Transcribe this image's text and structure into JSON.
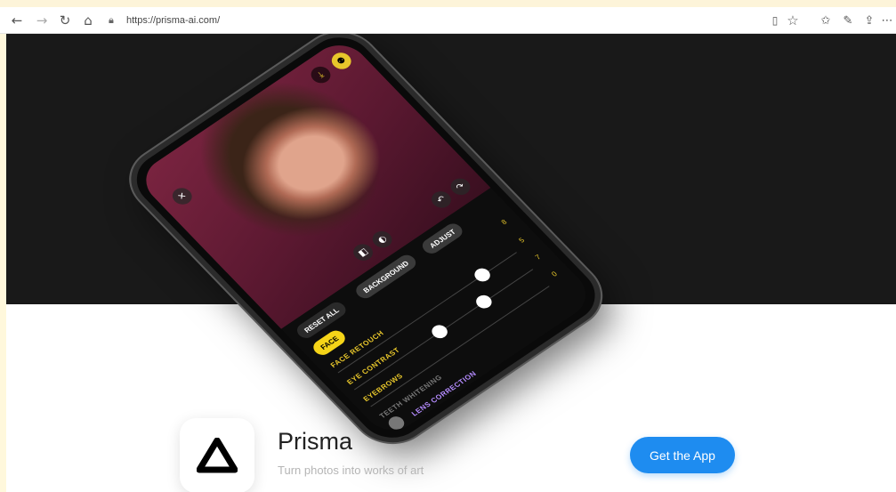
{
  "browser": {
    "url": "https://prisma-ai.com/",
    "icons": {
      "back": "back-arrow-icon",
      "forward": "forward-arrow-icon",
      "refresh": "refresh-icon",
      "home": "home-icon",
      "lock": "lock-icon",
      "reading_view": "reading-view-icon",
      "favorite": "star-icon",
      "favorites_bar": "favorites-icon",
      "pen": "pen-icon",
      "share": "share-icon"
    }
  },
  "phone_screen": {
    "tools": [
      "RESET ALL",
      "BACKGROUND",
      "ADJUST"
    ],
    "active_chip": "FACE",
    "settings": [
      {
        "label": "FACE RETOUCH",
        "value": "5"
      },
      {
        "label": "EYE CONTRAST",
        "value": "7"
      },
      {
        "label": "EYEBROWS",
        "value": "0"
      },
      {
        "label": "TEETH WHITENING",
        "value": ""
      },
      {
        "label": "LENS CORRECTION",
        "value": ""
      }
    ],
    "top_value": "8"
  },
  "app": {
    "name": "Prisma",
    "tagline": "Turn photos into works of art",
    "cta": "Get the App"
  },
  "colors": {
    "hero_bg": "#191919",
    "cta_blue": "#1e8cf0",
    "accent_yellow": "#e7c62b"
  }
}
